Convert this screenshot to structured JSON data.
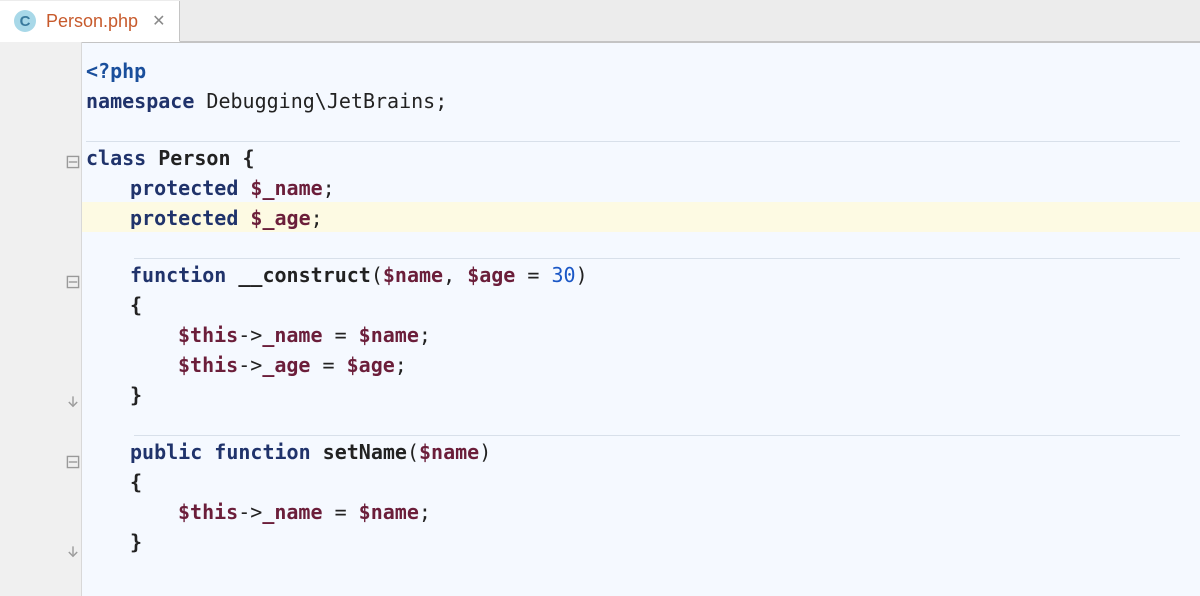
{
  "tab": {
    "icon_letter": "C",
    "label": "Person.php",
    "close_glyph": "✕"
  },
  "code": {
    "l1_open": "<?php",
    "l2_kw": "namespace",
    "l2_rest": " Debugging\\JetBrains;",
    "l3_kw": "class",
    "l3_rest": " Person {",
    "l4_kw": "protected",
    "l4_var": " $_name",
    "l4_end": ";",
    "l5_kw": "protected",
    "l5_var": " $_age",
    "l5_end": ";",
    "l6_kw": "function",
    "l6_name": " __construct",
    "l6_open": "(",
    "l6_p1": "$name",
    "l6_c": ", ",
    "l6_p2": "$age",
    "l6_eq": " = ",
    "l6_num": "30",
    "l6_close": ")",
    "l7": "{",
    "l8_this": "$this",
    "l8_arr": "->",
    "l8_prop": "_name",
    "l8_eq": " = ",
    "l8_val": "$name",
    "l8_end": ";",
    "l9_this": "$this",
    "l9_arr": "->",
    "l9_prop": "_age",
    "l9_eq": " = ",
    "l9_val": "$age",
    "l9_end": ";",
    "l10": "}",
    "l11_kw1": "public",
    "l11_kw2": " function",
    "l11_name": " setName",
    "l11_open": "(",
    "l11_p1": "$name",
    "l11_close": ")",
    "l12": "{",
    "l13_this": "$this",
    "l13_arr": "->",
    "l13_prop": "_name",
    "l13_eq": " = ",
    "l13_val": "$name",
    "l13_end": ";",
    "l14": "}"
  }
}
